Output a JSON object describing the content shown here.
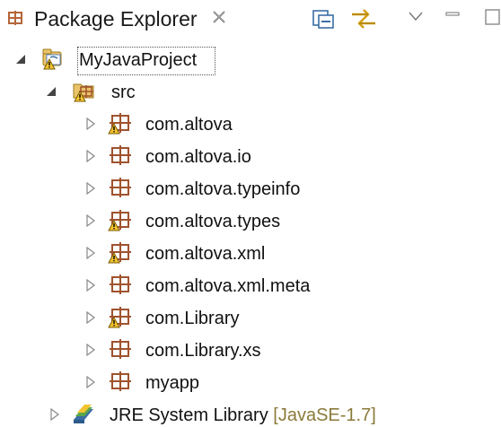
{
  "view": {
    "title": "Package Explorer",
    "icons": {
      "tab": "package-explorer-icon",
      "close": "close-icon",
      "collapse_all": "collapse-all-icon",
      "link_with_editor": "link-with-editor-icon",
      "view_menu": "view-menu-icon",
      "minimize": "minimize-icon",
      "maximize": "maximize-icon"
    }
  },
  "tree": {
    "project": {
      "label": "MyJavaProject",
      "expanded": true,
      "selected": true,
      "icon": "java-project-warning-icon"
    },
    "source_folder": {
      "label": "src",
      "expanded": true,
      "icon": "source-folder-warning-icon"
    },
    "packages": [
      {
        "label": "com.altova",
        "warning": true
      },
      {
        "label": "com.altova.io",
        "warning": false
      },
      {
        "label": "com.altova.typeinfo",
        "warning": false
      },
      {
        "label": "com.altova.types",
        "warning": true
      },
      {
        "label": "com.altova.xml",
        "warning": true
      },
      {
        "label": "com.altova.xml.meta",
        "warning": false
      },
      {
        "label": "com.Library",
        "warning": true
      },
      {
        "label": "com.Library.xs",
        "warning": false
      },
      {
        "label": "myapp",
        "warning": false
      }
    ],
    "library": {
      "label": "JRE System Library",
      "decoration": "[JavaSE-1.7]",
      "icon": "library-icon"
    }
  },
  "colors": {
    "package_icon": "#a0522d",
    "warning": "#f4c430",
    "twisty": "#888888",
    "decoration_text": "#8a7a3a"
  }
}
